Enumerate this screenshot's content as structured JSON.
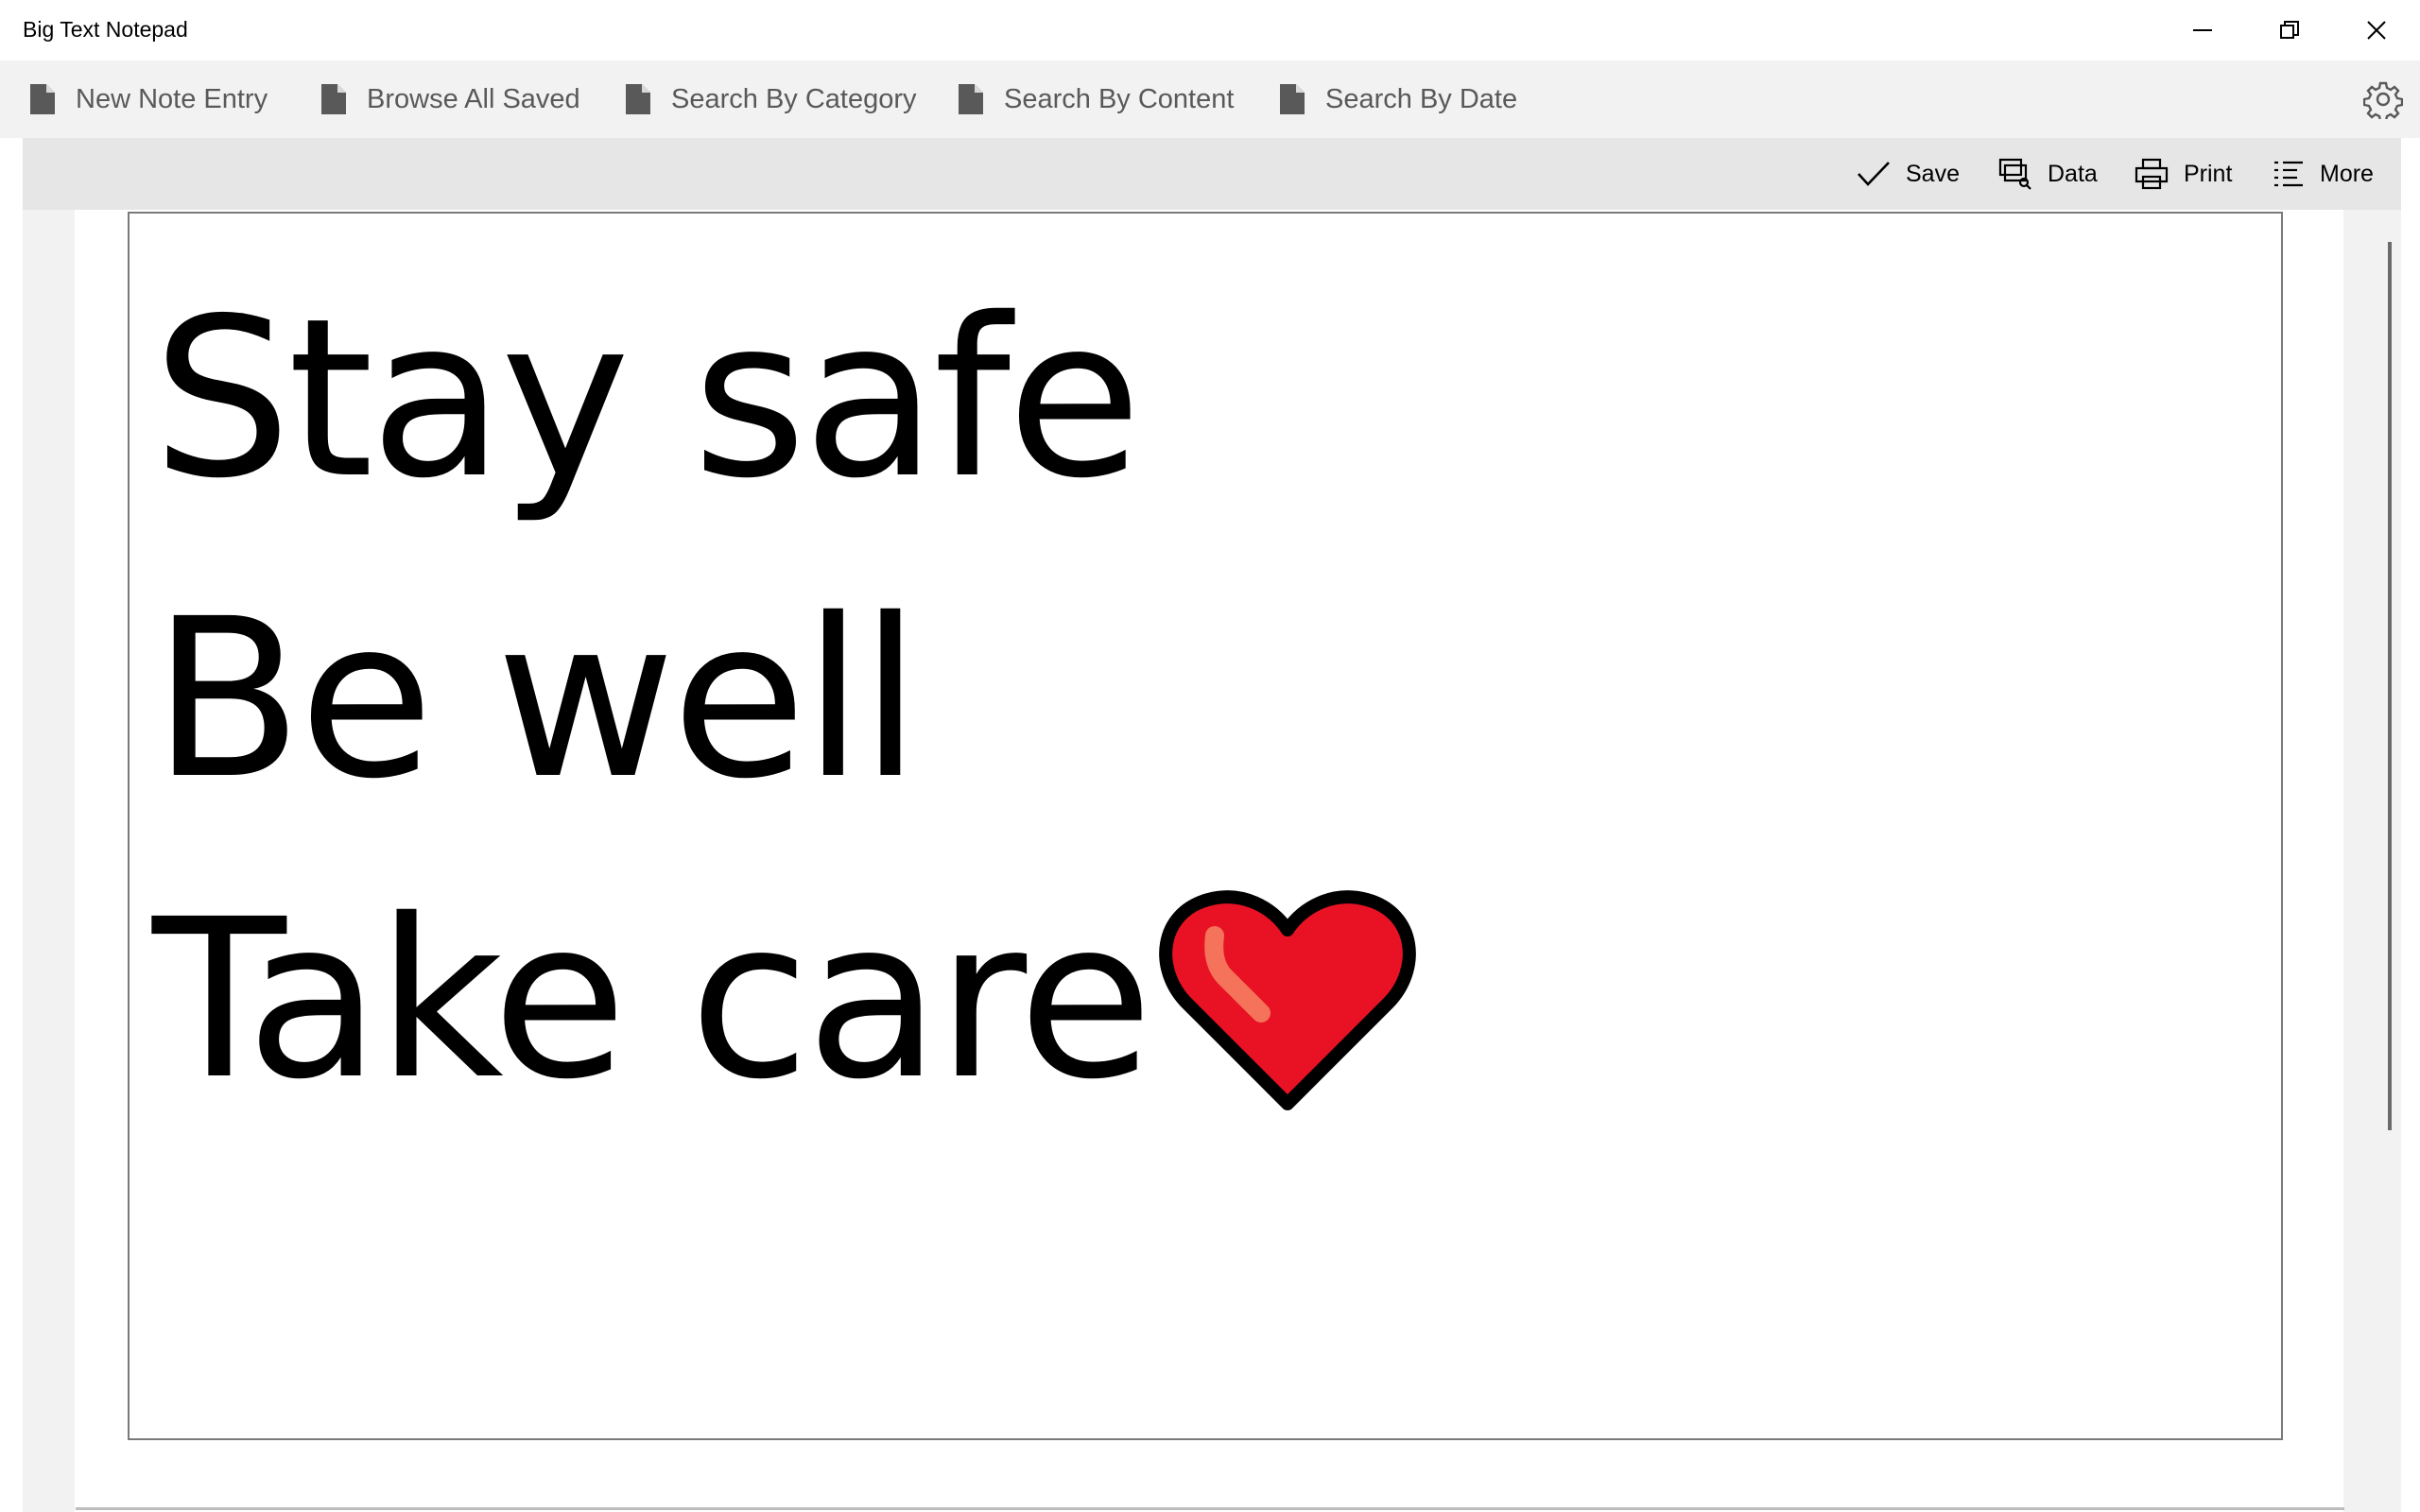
{
  "window": {
    "title": "Big Text Notepad"
  },
  "nav": {
    "items": [
      {
        "label": "New Note Entry",
        "icon": "document-icon"
      },
      {
        "label": "Browse All Saved",
        "icon": "document-icon"
      },
      {
        "label": "Search By Category",
        "icon": "document-icon"
      },
      {
        "label": "Search By Content",
        "icon": "document-icon"
      },
      {
        "label": "Search By Date",
        "icon": "document-icon"
      }
    ],
    "settings_icon": "gear-icon"
  },
  "commands": {
    "save_label": "Save",
    "data_label": "Data",
    "print_label": "Print",
    "more_label": "More"
  },
  "note": {
    "lines": [
      "Stay safe",
      "Be well",
      "Take care"
    ],
    "emoji": "red-heart-icon"
  },
  "colors": {
    "heart_fill": "#e81224",
    "heart_highlight": "#f4735a"
  }
}
